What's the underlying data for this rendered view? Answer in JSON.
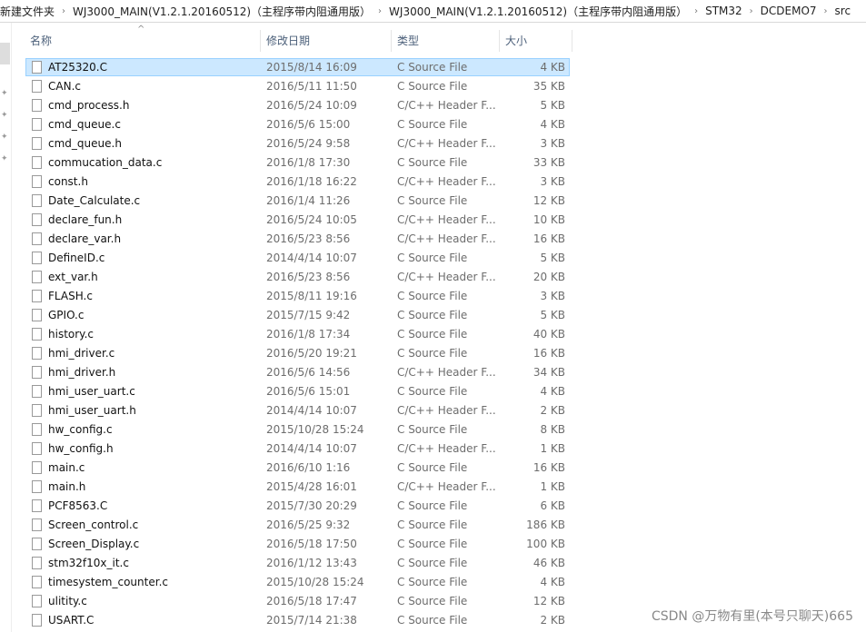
{
  "breadcrumb": [
    "新建文件夹",
    "WJ3000_MAIN(V1.2.1.20160512)（主程序带内阻通用版）",
    "WJ3000_MAIN(V1.2.1.20160512)（主程序带内阻通用版）",
    "STM32",
    "DCDEMO7",
    "src"
  ],
  "columns": {
    "name": "名称",
    "date": "修改日期",
    "type": "类型",
    "size": "大小"
  },
  "selected_index": 0,
  "files": [
    [
      "AT25320.C",
      "2015/8/14 16:09",
      "C Source File",
      "4 KB"
    ],
    [
      "CAN.c",
      "2016/5/11 11:50",
      "C Source File",
      "35 KB"
    ],
    [
      "cmd_process.h",
      "2016/5/24 10:09",
      "C/C++ Header F...",
      "5 KB"
    ],
    [
      "cmd_queue.c",
      "2016/5/6 15:00",
      "C Source File",
      "4 KB"
    ],
    [
      "cmd_queue.h",
      "2016/5/24 9:58",
      "C/C++ Header F...",
      "3 KB"
    ],
    [
      "commucation_data.c",
      "2016/1/8 17:30",
      "C Source File",
      "33 KB"
    ],
    [
      "const.h",
      "2016/1/18 16:22",
      "C/C++ Header F...",
      "3 KB"
    ],
    [
      "Date_Calculate.c",
      "2016/1/4 11:26",
      "C Source File",
      "12 KB"
    ],
    [
      "declare_fun.h",
      "2016/5/24 10:05",
      "C/C++ Header F...",
      "10 KB"
    ],
    [
      "declare_var.h",
      "2016/5/23 8:56",
      "C/C++ Header F...",
      "16 KB"
    ],
    [
      "DefineID.c",
      "2014/4/14 10:07",
      "C Source File",
      "5 KB"
    ],
    [
      "ext_var.h",
      "2016/5/23 8:56",
      "C/C++ Header F...",
      "20 KB"
    ],
    [
      "FLASH.c",
      "2015/8/11 19:16",
      "C Source File",
      "3 KB"
    ],
    [
      "GPIO.c",
      "2015/7/15 9:42",
      "C Source File",
      "5 KB"
    ],
    [
      "history.c",
      "2016/1/8 17:34",
      "C Source File",
      "40 KB"
    ],
    [
      "hmi_driver.c",
      "2016/5/20 19:21",
      "C Source File",
      "16 KB"
    ],
    [
      "hmi_driver.h",
      "2016/5/6 14:56",
      "C/C++ Header F...",
      "34 KB"
    ],
    [
      "hmi_user_uart.c",
      "2016/5/6 15:01",
      "C Source File",
      "4 KB"
    ],
    [
      "hmi_user_uart.h",
      "2014/4/14 10:07",
      "C/C++ Header F...",
      "2 KB"
    ],
    [
      "hw_config.c",
      "2015/10/28 15:24",
      "C Source File",
      "8 KB"
    ],
    [
      "hw_config.h",
      "2014/4/14 10:07",
      "C/C++ Header F...",
      "1 KB"
    ],
    [
      "main.c",
      "2016/6/10 1:16",
      "C Source File",
      "16 KB"
    ],
    [
      "main.h",
      "2015/4/28 16:01",
      "C/C++ Header F...",
      "1 KB"
    ],
    [
      "PCF8563.C",
      "2015/7/30 20:29",
      "C Source File",
      "6 KB"
    ],
    [
      "Screen_control.c",
      "2016/5/25 9:32",
      "C Source File",
      "186 KB"
    ],
    [
      "Screen_Display.c",
      "2016/5/18 17:50",
      "C Source File",
      "100 KB"
    ],
    [
      "stm32f10x_it.c",
      "2016/1/12 13:43",
      "C Source File",
      "46 KB"
    ],
    [
      "timesystem_counter.c",
      "2015/10/28 15:24",
      "C Source File",
      "4 KB"
    ],
    [
      "ulitity.c",
      "2016/5/18 17:47",
      "C Source File",
      "12 KB"
    ],
    [
      "USART.C",
      "2015/7/14 21:38",
      "C Source File",
      "2 KB"
    ]
  ],
  "watermark": "CSDN @万物有里(本号只聊天)665"
}
